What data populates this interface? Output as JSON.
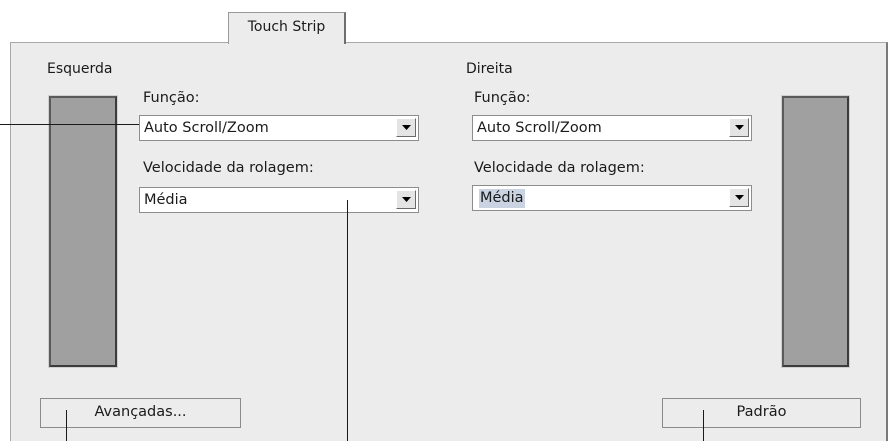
{
  "tab": {
    "label": "Touch Strip"
  },
  "left_group": {
    "title": "Esquerda",
    "function_label": "Função:",
    "function_value": "Auto Scroll/Zoom",
    "speed_label": "Velocidade da rolagem:",
    "speed_value": "Média"
  },
  "right_group": {
    "title": "Direita",
    "function_label": "Função:",
    "function_value": "Auto Scroll/Zoom",
    "speed_label": "Velocidade da rolagem:",
    "speed_value": "Média"
  },
  "buttons": {
    "advanced": "Avançadas...",
    "default": "Padrão"
  }
}
